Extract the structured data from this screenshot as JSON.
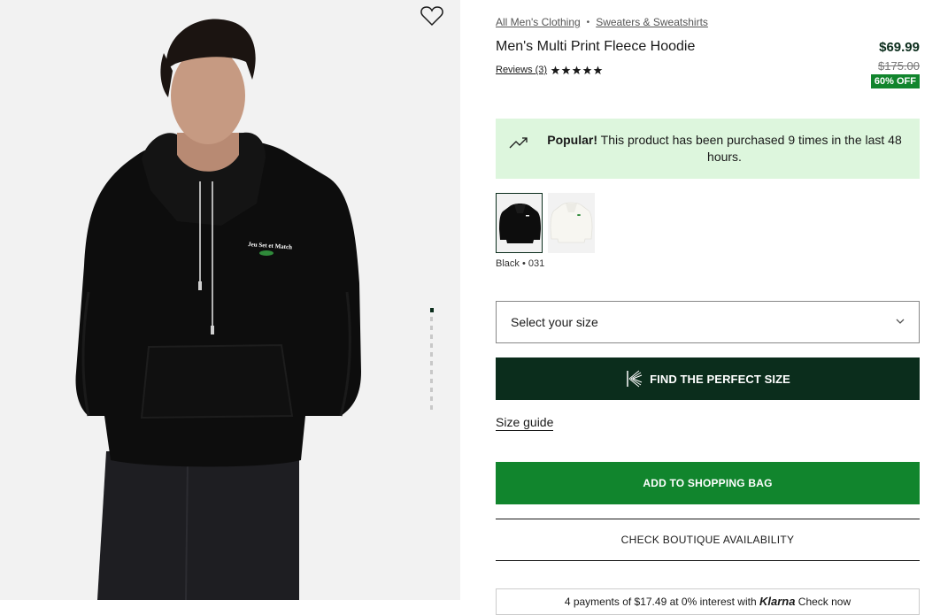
{
  "breadcrumb": {
    "items": [
      "All Men's Clothing",
      "Sweaters & Sweatshirts"
    ],
    "separator": "•"
  },
  "product": {
    "title": "Men's Multi Print Fleece Hoodie",
    "reviews_label": "Reviews (3)",
    "rating": 5,
    "rating_max": 5,
    "price": "$69.99",
    "original_price": "$175.00",
    "discount": "60% OFF",
    "chest_print": "Jeu Set et Match"
  },
  "popular": {
    "bold": "Popular!",
    "text": "This product has been purchased 9 times in the last 48 hours."
  },
  "colors": {
    "selected_label": "Black • 031",
    "options": [
      "black-hoodie",
      "white-hoodie"
    ]
  },
  "size": {
    "placeholder": "Select your size"
  },
  "buttons": {
    "perfect_size": "FIND THE PERFECT SIZE",
    "size_guide": "Size guide",
    "add_to_bag": "ADD TO SHOPPING BAG",
    "boutique": "CHECK BOUTIQUE AVAILABILITY"
  },
  "klarna": {
    "text_before": "4 payments of $17.49 at 0% interest with",
    "brand": "Klarna",
    "text_after": "Check now"
  },
  "gallery": {
    "image_count": 12,
    "active_index": 0
  },
  "colors_theme": {
    "dark_green": "#0b2d1c",
    "green": "#11852d",
    "popular_bg": "#ddf6dd"
  }
}
